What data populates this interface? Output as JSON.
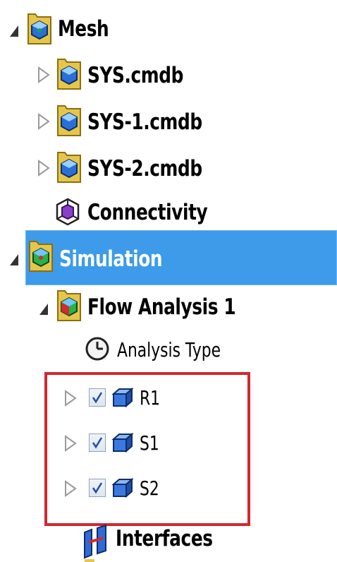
{
  "tree": {
    "mesh": {
      "label": "Mesh",
      "icon": "mesh-folder-icon"
    },
    "mesh_children": [
      {
        "label": "SYS.cmdb",
        "icon": "cmdb-folder-icon"
      },
      {
        "label": "SYS-1.cmdb",
        "icon": "cmdb-folder-icon"
      },
      {
        "label": "SYS-2.cmdb",
        "icon": "cmdb-folder-icon"
      },
      {
        "label": "Connectivity",
        "icon": "connectivity-icon"
      }
    ],
    "simulation": {
      "label": "Simulation",
      "icon": "simulation-folder-icon",
      "selected": true
    },
    "flow_analysis": {
      "label": "Flow Analysis 1",
      "icon": "analysis-folder-icon"
    },
    "analysis_type": {
      "label": "Analysis Type",
      "icon": "clock-icon"
    },
    "parts": [
      {
        "label": "R1",
        "checked": true,
        "icon": "part-box-icon"
      },
      {
        "label": "S1",
        "checked": true,
        "icon": "part-box-icon"
      },
      {
        "label": "S2",
        "checked": true,
        "icon": "part-box-icon"
      }
    ],
    "interfaces": {
      "label": "Interfaces",
      "icon": "interfaces-icon"
    }
  },
  "colors": {
    "selection": "#3d9be9",
    "highlight_box": "#d1282e",
    "folder": "#e6c64a",
    "part_box": "#2f6bd6"
  }
}
